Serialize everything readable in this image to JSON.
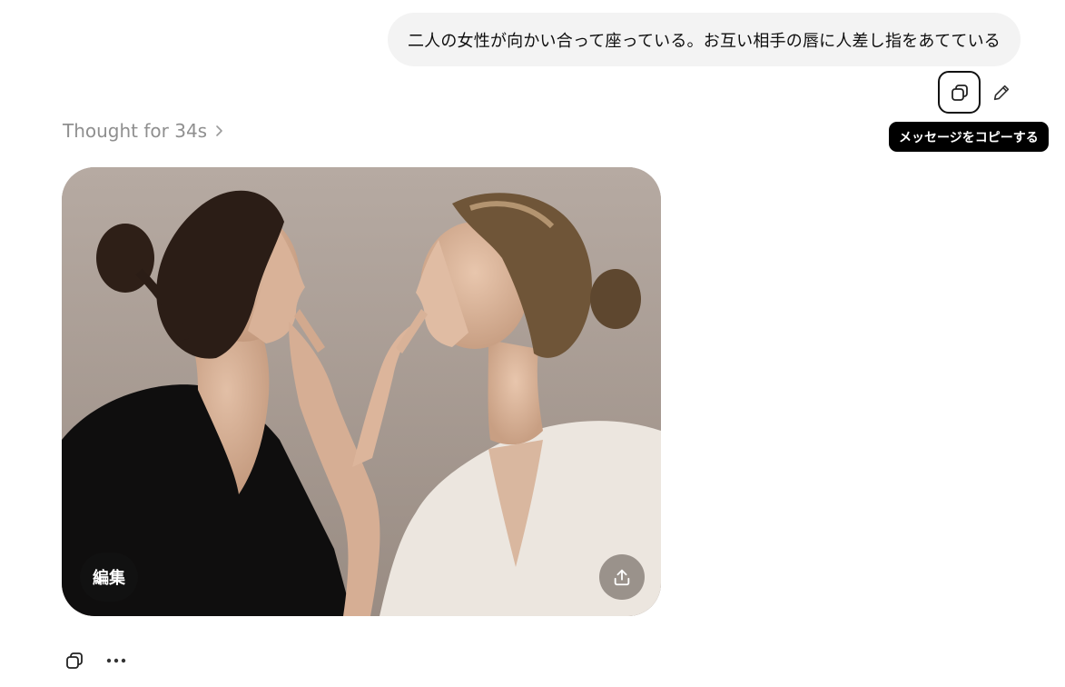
{
  "user_message": {
    "text": "二人の女性が向かい合って座っている。お互い相手の唇に人差し指をあてている"
  },
  "user_actions": {
    "copy_icon": "copy-icon",
    "edit_icon": "pencil-icon"
  },
  "tooltip": {
    "text": "メッセージをコピーする"
  },
  "thought": {
    "label": "Thought for 34s",
    "chevron_icon": "chevron-right-icon"
  },
  "image": {
    "edit_label": "編集",
    "share_icon": "share-upload-icon"
  },
  "response_actions": {
    "copy_icon": "copy-icon",
    "more_icon": "more-horizontal-icon"
  }
}
